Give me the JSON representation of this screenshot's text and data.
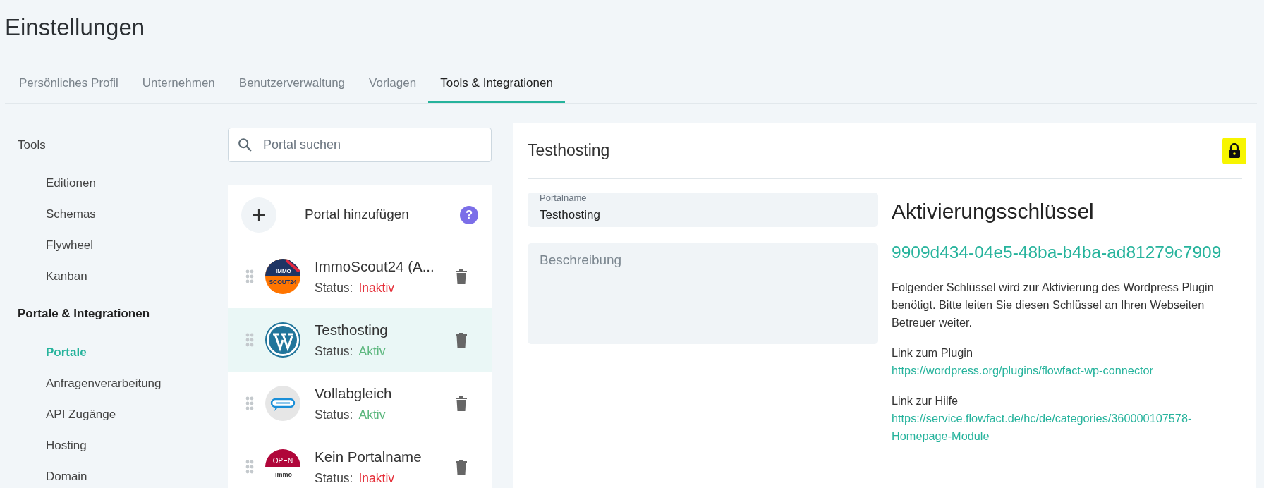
{
  "page_title": "Einstellungen",
  "tabs": [
    {
      "label": "Persönliches Profil",
      "selected": false
    },
    {
      "label": "Unternehmen",
      "selected": false
    },
    {
      "label": "Benutzerverwaltung",
      "selected": false
    },
    {
      "label": "Vorlagen",
      "selected": false
    },
    {
      "label": "Tools & Integrationen",
      "selected": true
    }
  ],
  "sidebar": {
    "sections": [
      {
        "heading": "Tools",
        "bold": false,
        "items": [
          {
            "label": "Editionen",
            "selected": false
          },
          {
            "label": "Schemas",
            "selected": false
          },
          {
            "label": "Flywheel",
            "selected": false
          },
          {
            "label": "Kanban",
            "selected": false
          }
        ]
      },
      {
        "heading": "Portale & Integrationen",
        "bold": true,
        "items": [
          {
            "label": "Portale",
            "selected": true
          },
          {
            "label": "Anfragenverarbeitung",
            "selected": false
          },
          {
            "label": "API Zugänge",
            "selected": false
          },
          {
            "label": "Hosting",
            "selected": false
          },
          {
            "label": "Domain",
            "selected": false
          }
        ]
      }
    ]
  },
  "search": {
    "placeholder": "Portal suchen"
  },
  "add_portal": {
    "label": "Portal hinzufügen",
    "help": "?"
  },
  "portals": [
    {
      "name": "ImmoScout24 (A...",
      "status_label": "Status:",
      "status": "Inaktiv",
      "active": false,
      "selected": false,
      "kind": "immoscout",
      "logo_text": [
        "IMMO",
        "SCOUT24"
      ]
    },
    {
      "name": "Testhosting",
      "status_label": "Status:",
      "status": "Aktiv",
      "active": true,
      "selected": true,
      "kind": "wordpress"
    },
    {
      "name": "Vollabgleich",
      "status_label": "Status:",
      "status": "Aktiv",
      "active": true,
      "selected": false,
      "kind": "willhaben"
    },
    {
      "name": "Kein Portalname",
      "status_label": "Status:",
      "status": "Inaktiv",
      "active": false,
      "selected": false,
      "kind": "openimmo",
      "logo_text": [
        "OPEN",
        "immo"
      ]
    }
  ],
  "detail": {
    "title": "Testhosting",
    "portalname": {
      "label": "Portalname",
      "value": "Testhosting"
    },
    "description": {
      "placeholder": "Beschreibung"
    },
    "key_heading": "Aktivierungsschlüssel",
    "key": "9909d434-04e5-48ba-b4ba-ad81279c7909",
    "explanation": "Folgender Schlüssel wird zur Aktivierung des Wordpress Plugin benötigt. Bitte leiten Sie diesen Schlüssel an Ihren Webseiten Betreuer weiter.",
    "links": [
      {
        "label": "Link zum Plugin",
        "url": "https://wordpress.org/plugins/flowfact-wp-connector"
      },
      {
        "label": "Link zur Hilfe",
        "url": "https://service.flowfact.de/hc/de/categories/360000107578-Homepage-Module"
      }
    ]
  }
}
